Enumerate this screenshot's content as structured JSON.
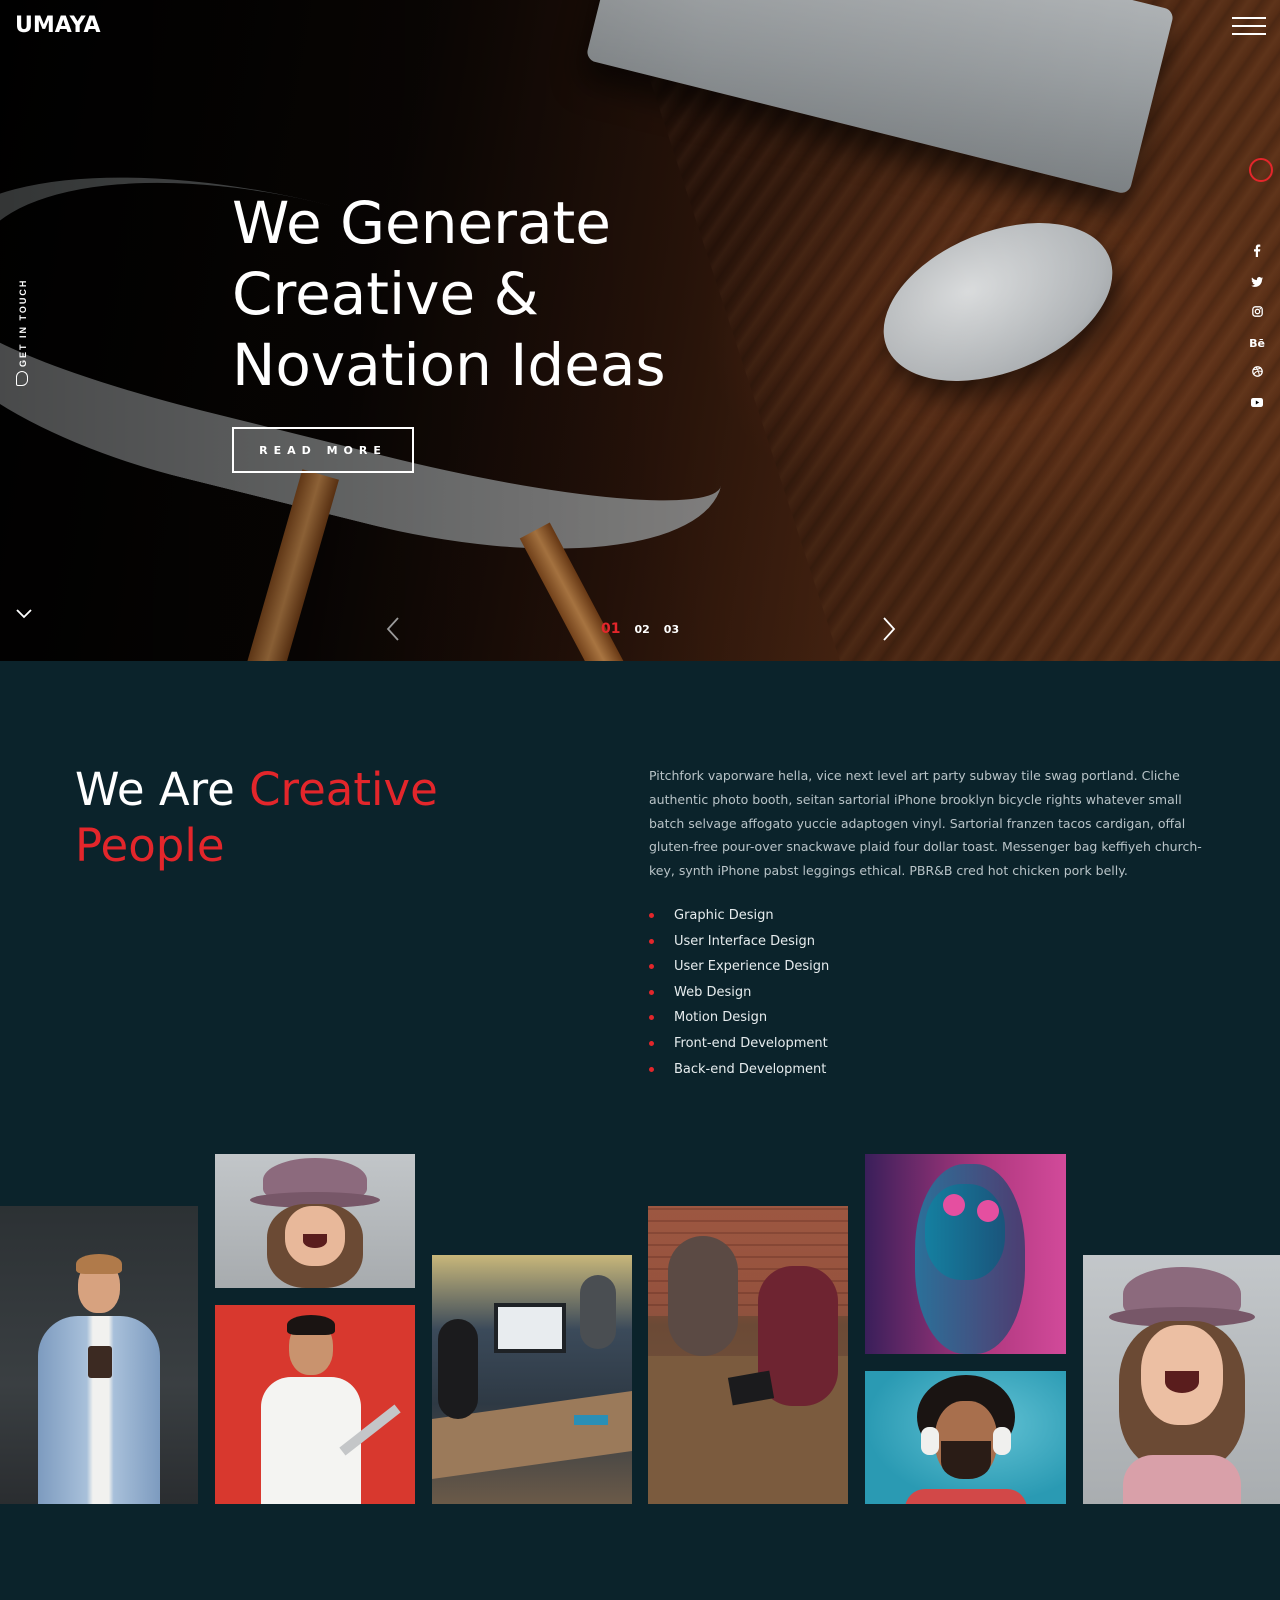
{
  "brand": {
    "logo": "UMAYA",
    "accent_color": "#e3262b",
    "background": "#0b232b"
  },
  "header": {
    "menu_icon": "hamburger-menu-icon"
  },
  "sidebar": {
    "get_in_touch": "GET IN TOUCH"
  },
  "social": {
    "items": [
      "f",
      "t",
      "ig",
      "Bē",
      "dr",
      "yt"
    ]
  },
  "hero": {
    "title_lines": [
      "We Generate",
      "Creative &",
      "Novation Ideas"
    ],
    "cta": "READ MORE",
    "slides": [
      "01",
      "02",
      "03"
    ],
    "active_slide": "01"
  },
  "about": {
    "title_white": "We Are ",
    "title_accent_1": "Creative",
    "title_accent_2": "People",
    "paragraph": "Pitchfork vaporware hella, vice next level art party subway tile swag portland. Cliche authentic photo booth, seitan sartorial iPhone brooklyn bicycle rights whatever small batch selvage affogato yuccie adaptogen vinyl. Sartorial franzen tacos cardigan, offal gluten-free pour-over snackwave plaid four dollar toast. Messenger bag keffiyeh church-key, synth iPhone pabst leggings ethical. PBR&B cred hot chicken pork belly.",
    "services": [
      "Graphic Design",
      "User Interface Design",
      "User Experience Design",
      "Web Design",
      "Motion Design",
      "Front-end Development",
      "Back-end Development"
    ]
  }
}
